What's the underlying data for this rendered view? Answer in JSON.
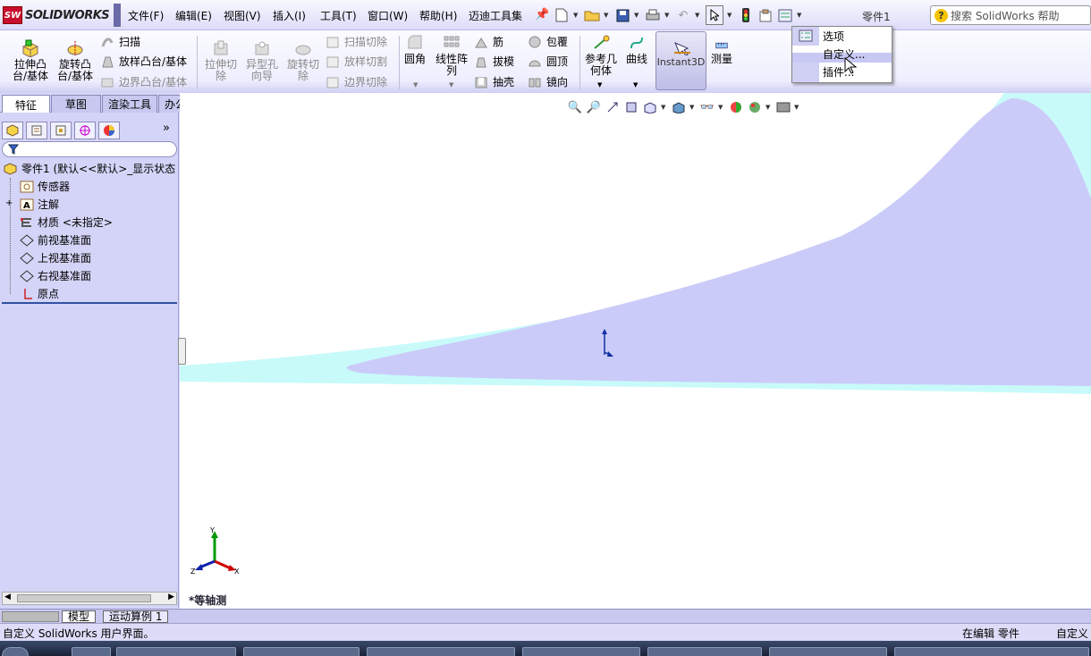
{
  "app": {
    "brand": "SOLIDWORKS",
    "doc_title": "零件1"
  },
  "menu": [
    "文件(F)",
    "编辑(E)",
    "视图(V)",
    "插入(I)",
    "工具(T)",
    "窗口(W)",
    "帮助(H)",
    "迈迪工具集"
  ],
  "search": {
    "placeholder": "搜索 SolidWorks 帮助"
  },
  "commands": {
    "extrude_boss": "拉伸凸\n台/基体",
    "revolve_boss": "旋转凸\n台/基体",
    "sweep": "扫描",
    "loft": "放样凸台/基体",
    "boundary_boss": "边界凸台/基体",
    "extrude_cut": "拉伸切\n除",
    "hole_wizard": "异型孔\n向导",
    "revolve_cut": "旋转切\n除",
    "swept_cut": "扫描切除",
    "lofted_cut": "放样切割",
    "boundary_cut": "边界切除",
    "fillet": "圆角",
    "linear_pattern": "线性阵\n列",
    "rib": "筋",
    "draft": "拔模",
    "shell": "抽壳",
    "wrap": "包覆",
    "dome": "圆顶",
    "mirror": "镜向",
    "ref_geometry": "参考几\n何体",
    "curves": "曲线",
    "instant3d": "Instant3D",
    "measure": "测量"
  },
  "tabs": [
    "特征",
    "草图",
    "渲染工具",
    "办公室产品"
  ],
  "tree": {
    "root": "零件1 (默认<<默认>_显示状态",
    "items": [
      "传感器",
      "注解",
      "材质 <未指定>",
      "前视基准面",
      "上视基准面",
      "右视基准面",
      "原点"
    ]
  },
  "view_name": "*等轴测",
  "bottom_tabs": [
    "模型",
    "运动算例 1"
  ],
  "status": {
    "left": "自定义 SolidWorks 用户界面。",
    "mid": "在编辑 零件",
    "right": "自定义"
  },
  "dropdown": {
    "items": [
      "选项",
      "自定义...",
      "插件..."
    ],
    "highlighted": 1
  },
  "colors": {
    "accent": "#c8c8f8",
    "body": "#cbcbf9",
    "glow": "#c8fafa"
  }
}
